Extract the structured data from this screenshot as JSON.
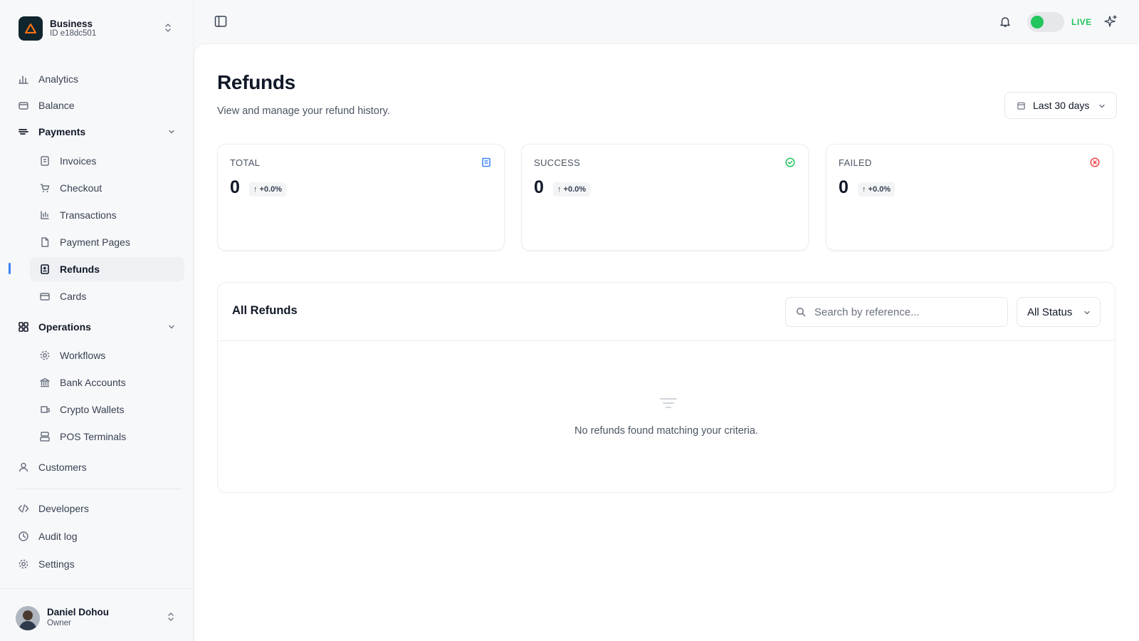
{
  "business": {
    "name": "Business",
    "id_label": "ID e18dc501"
  },
  "sidebar": {
    "analytics": "Analytics",
    "balance": "Balance",
    "payments": "Payments",
    "invoices": "Invoices",
    "checkout": "Checkout",
    "transactions": "Transactions",
    "payment_pages": "Payment Pages",
    "refunds": "Refunds",
    "cards": "Cards",
    "operations": "Operations",
    "workflows": "Workflows",
    "bank_accounts": "Bank Accounts",
    "crypto_wallets": "Crypto Wallets",
    "pos_terminals": "POS Terminals",
    "customers": "Customers",
    "developers": "Developers",
    "audit_log": "Audit log",
    "settings": "Settings"
  },
  "user": {
    "name": "Daniel Dohou",
    "role": "Owner"
  },
  "topbar": {
    "live_label": "LIVE",
    "live_on": true
  },
  "page": {
    "title": "Refunds",
    "subtitle": "View and manage your refund history.",
    "date_range": "Last 30 days"
  },
  "stats": [
    {
      "label": "TOTAL",
      "value": "0",
      "change": "↑ +0.0%",
      "icon": "receipt-icon",
      "color": "#3b82f6"
    },
    {
      "label": "SUCCESS",
      "value": "0",
      "change": "↑ +0.0%",
      "icon": "check-circle-icon",
      "color": "#22c55e"
    },
    {
      "label": "FAILED",
      "value": "0",
      "change": "↑ +0.0%",
      "icon": "x-circle-icon",
      "color": "#ef4444"
    }
  ],
  "refunds": {
    "title": "All Refunds",
    "search_placeholder": "Search by reference...",
    "status_filter": "All Status",
    "empty_text": "No refunds found matching your criteria."
  }
}
